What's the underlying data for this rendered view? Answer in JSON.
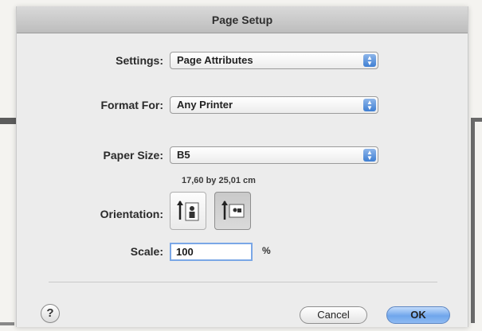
{
  "dialog": {
    "title": "Page Setup"
  },
  "settings": {
    "label": "Settings:",
    "value": "Page Attributes"
  },
  "format_for": {
    "label": "Format For:",
    "value": "Any Printer"
  },
  "paper_size": {
    "label": "Paper Size:",
    "value": "B5",
    "dimensions": "17,60 by 25,01 cm"
  },
  "orientation": {
    "label": "Orientation:",
    "selected": "portrait",
    "options": [
      "portrait",
      "landscape"
    ]
  },
  "scale": {
    "label": "Scale:",
    "value": "100",
    "unit": "%"
  },
  "buttons": {
    "help": "?",
    "cancel": "Cancel",
    "ok": "OK"
  },
  "icons": {
    "popup_arrows": "up-down-arrows-icon",
    "portrait": "portrait-orientation-icon",
    "landscape": "landscape-orientation-icon",
    "help": "question-mark-icon"
  },
  "colors": {
    "accent": "#6fa6ec",
    "focus_ring": "#7aa7e6"
  }
}
